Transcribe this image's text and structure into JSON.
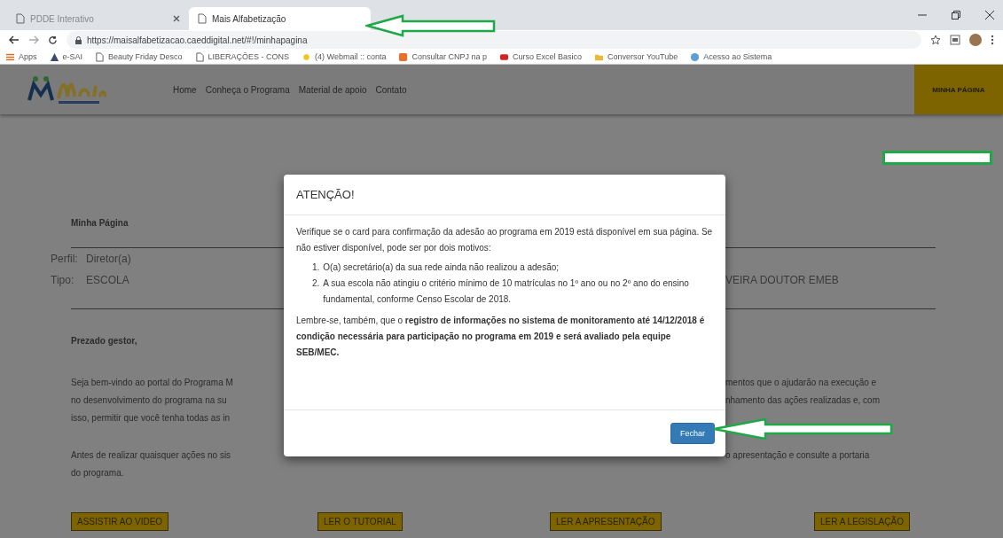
{
  "browser": {
    "tabs": [
      {
        "title": "PDDE Interativo",
        "selected": false
      },
      {
        "title": "Mais Alfabetização",
        "selected": true
      }
    ],
    "url": "https://maisalfabetizacao.caeddigital.net/#!/minhapagina",
    "bookmarks": [
      {
        "label": "Apps",
        "kind": "apps"
      },
      {
        "label": "e-SAI",
        "kind": "drive"
      },
      {
        "label": "Beauty Friday Desco",
        "kind": "page"
      },
      {
        "label": "LIBERAÇÕES - CONS",
        "kind": "page"
      },
      {
        "label": "(4) Webmail :: conta",
        "kind": "mail"
      },
      {
        "label": "Consultar CNPJ na p",
        "kind": "search"
      },
      {
        "label": "Curso Excel Basico",
        "kind": "video"
      },
      {
        "label": "Conversor YouTube",
        "kind": "folder"
      },
      {
        "label": "Acesso ao Sistema",
        "kind": "globe"
      }
    ]
  },
  "header": {
    "nav": [
      "Home",
      "Conheça o Programa",
      "Material de apoio",
      "Contato"
    ],
    "account_button": "MINHA PÁGINA"
  },
  "page": {
    "heading": "Minha Página",
    "profile": [
      {
        "label": "Perfil:",
        "value": "Diretor(a)"
      },
      {
        "label": "Tipo:",
        "value": "ESCOLA",
        "right": "VEIRA DOUTOR EMEB"
      }
    ],
    "greeting": "Prezado gestor,",
    "paragraph_1": [
      {
        "left": "Seja bem-vindo ao portal do Programa M",
        "right": "mentos que o ajudarão na execução e"
      },
      {
        "left": "no desenvolvimento do programa na su",
        "right": "nhamento das ações realizadas e, com"
      },
      {
        "left": "isso, permitir que você tenha todas as in"
      }
    ],
    "paragraph_2": [
      {
        "left": "Antes de realizar quaisquer ações no sis",
        "right": "o apresentação e consulte a portaria"
      },
      {
        "left": "do programa."
      }
    ],
    "buttons": [
      "ASSISTIR AO VIDEO",
      "LER O TUTORIAL",
      "LER A APRESENTAÇÃO",
      "LER A LEGISLAÇÃO"
    ]
  },
  "modal": {
    "title": "ATENÇÃO!",
    "intro": "Verifique se o card para confirmação da adesão ao programa em 2019 está disponível em sua página. Se não estiver disponível, pode ser por dois motivos:",
    "reasons": [
      {
        "number": "1.",
        "text": "O(a) secretário(a) da sua rede ainda não realizou a adesão;"
      },
      {
        "number": "2.",
        "text": "A sua escola não atingiu o critério mínimo de 10 matrículas no 1º ano ou no 2º ano do ensino fundamental, conforme Censo Escolar de 2018."
      }
    ],
    "note": "Lembre-se, também, que o **registro de informações no sistema de monitoramento até 14/12/2018 é condição necessária para participação no programa em 2019 e será avaliado pela equipe SEB/MEC.**",
    "close_button": "Fechar"
  }
}
